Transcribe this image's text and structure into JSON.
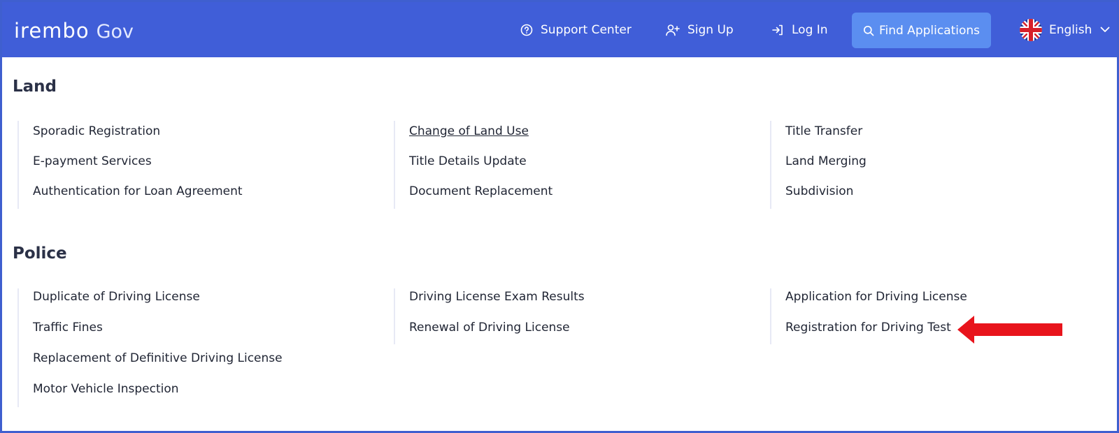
{
  "header": {
    "logo_brand": "irembo",
    "logo_sub": "Gov",
    "support_label": "Support Center",
    "signup_label": "Sign Up",
    "login_label": "Log In",
    "find_label": "Find Applications",
    "language_label": "English",
    "bg_color": "#405ed8",
    "find_bg_color": "#5b8ef0"
  },
  "sections": [
    {
      "title": "Land",
      "columns": [
        [
          "Sporadic Registration",
          "E-payment Services",
          "Authentication for Loan Agreement"
        ],
        [
          "Change of Land Use",
          "Title Details Update",
          "Document Replacement"
        ],
        [
          "Title Transfer",
          "Land Merging",
          "Subdivision"
        ]
      ]
    },
    {
      "title": "Police",
      "columns": [
        [
          "Duplicate of Driving License",
          "Traffic Fines",
          "Replacement of Definitive Driving License",
          "Motor Vehicle Inspection"
        ],
        [
          "Driving License Exam Results",
          "Renewal of Driving License"
        ],
        [
          "Application for Driving License",
          "Registration for Driving Test"
        ]
      ]
    }
  ],
  "annotation": {
    "arrow_color": "#e8141c"
  }
}
